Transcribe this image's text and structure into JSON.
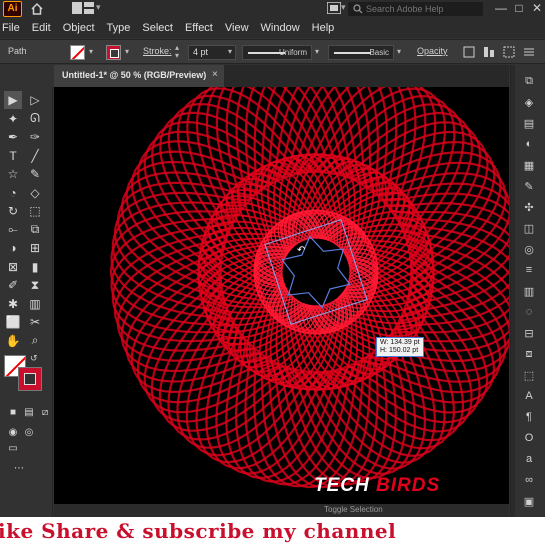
{
  "app": {
    "logo_text": "Ai",
    "menu": [
      "File",
      "Edit",
      "Object",
      "Type",
      "Select",
      "Effect",
      "View",
      "Window",
      "Help"
    ],
    "search_placeholder": "Search Adobe Help",
    "window_controls": [
      "—",
      "□",
      "✕"
    ]
  },
  "control_bar": {
    "selection_type": "Path",
    "stroke_label": "Stroke:",
    "stroke_value": "4 pt",
    "profile_label": "Uniform",
    "brush_label": "Basic",
    "opacity_label": "Opacity"
  },
  "document_tab": {
    "label": "Untitled-1* @ 50 % (RGB/Preview)",
    "close": "×"
  },
  "canvas": {
    "selection_readout": {
      "width": "W: 134.39 pt",
      "height": "H: 150.02 pt"
    },
    "brand_part1": "TECH",
    "brand_part2": "BIRDS",
    "status_text": "Toggle Selection"
  },
  "banner": {
    "text": "ike Share & subscribe my channel"
  },
  "colors": {
    "accent": "#c8102e",
    "art_red": "#e3001b",
    "canvas_bg": "#000000",
    "ui_bg": "#323232"
  }
}
